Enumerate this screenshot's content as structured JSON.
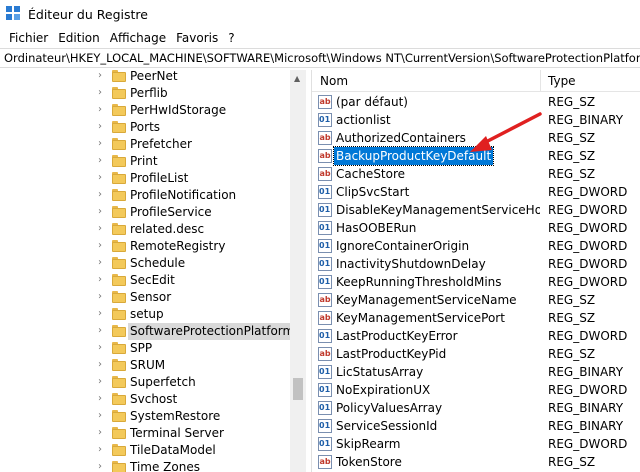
{
  "window": {
    "title": "Éditeur du Registre"
  },
  "menu": [
    "Fichier",
    "Edition",
    "Affichage",
    "Favoris",
    "?"
  ],
  "address": "Ordinateur\\HKEY_LOCAL_MACHINE\\SOFTWARE\\Microsoft\\Windows NT\\CurrentVersion\\SoftwareProtectionPlatform",
  "tree": {
    "items": [
      {
        "label": "PeerNet"
      },
      {
        "label": "Perflib"
      },
      {
        "label": "PerHwIdStorage"
      },
      {
        "label": "Ports"
      },
      {
        "label": "Prefetcher"
      },
      {
        "label": "Print"
      },
      {
        "label": "ProfileList"
      },
      {
        "label": "ProfileNotification"
      },
      {
        "label": "ProfileService"
      },
      {
        "label": "related.desc"
      },
      {
        "label": "RemoteRegistry"
      },
      {
        "label": "Schedule"
      },
      {
        "label": "SecEdit"
      },
      {
        "label": "Sensor"
      },
      {
        "label": "setup"
      },
      {
        "label": "SoftwareProtectionPlatform",
        "selected": true
      },
      {
        "label": "SPP"
      },
      {
        "label": "SRUM"
      },
      {
        "label": "Superfetch"
      },
      {
        "label": "Svchost"
      },
      {
        "label": "SystemRestore"
      },
      {
        "label": "Terminal Server"
      },
      {
        "label": "TileDataModel"
      },
      {
        "label": "Time Zones"
      }
    ]
  },
  "list": {
    "headers": {
      "name": "Nom",
      "type": "Type"
    },
    "rows": [
      {
        "name": "(par défaut)",
        "type": "REG_SZ",
        "kind": "sz"
      },
      {
        "name": "actionlist",
        "type": "REG_BINARY",
        "kind": "bin"
      },
      {
        "name": "AuthorizedContainers",
        "type": "REG_SZ",
        "kind": "sz"
      },
      {
        "name": "BackupProductKeyDefault",
        "type": "REG_SZ",
        "kind": "sz",
        "selected": true
      },
      {
        "name": "CacheStore",
        "type": "REG_SZ",
        "kind": "sz"
      },
      {
        "name": "ClipSvcStart",
        "type": "REG_DWORD",
        "kind": "bin"
      },
      {
        "name": "DisableKeyManagementServiceHostCa...",
        "type": "REG_DWORD",
        "kind": "bin"
      },
      {
        "name": "HasOOBERun",
        "type": "REG_DWORD",
        "kind": "bin"
      },
      {
        "name": "IgnoreContainerOrigin",
        "type": "REG_DWORD",
        "kind": "bin"
      },
      {
        "name": "InactivityShutdownDelay",
        "type": "REG_DWORD",
        "kind": "bin"
      },
      {
        "name": "KeepRunningThresholdMins",
        "type": "REG_DWORD",
        "kind": "bin"
      },
      {
        "name": "KeyManagementServiceName",
        "type": "REG_SZ",
        "kind": "sz"
      },
      {
        "name": "KeyManagementServicePort",
        "type": "REG_SZ",
        "kind": "sz"
      },
      {
        "name": "LastProductKeyError",
        "type": "REG_DWORD",
        "kind": "bin"
      },
      {
        "name": "LastProductKeyPid",
        "type": "REG_SZ",
        "kind": "sz"
      },
      {
        "name": "LicStatusArray",
        "type": "REG_BINARY",
        "kind": "bin"
      },
      {
        "name": "NoExpirationUX",
        "type": "REG_DWORD",
        "kind": "bin"
      },
      {
        "name": "PolicyValuesArray",
        "type": "REG_BINARY",
        "kind": "bin"
      },
      {
        "name": "ServiceSessionId",
        "type": "REG_BINARY",
        "kind": "bin"
      },
      {
        "name": "SkipRearm",
        "type": "REG_DWORD",
        "kind": "bin"
      },
      {
        "name": "TokenStore",
        "type": "REG_SZ",
        "kind": "sz"
      }
    ]
  },
  "icons": {
    "sz": "ab",
    "bin": "011"
  },
  "colors": {
    "selection": "#0078d7",
    "annotation_arrow": "#e02020",
    "folder": "#f3c95a"
  }
}
